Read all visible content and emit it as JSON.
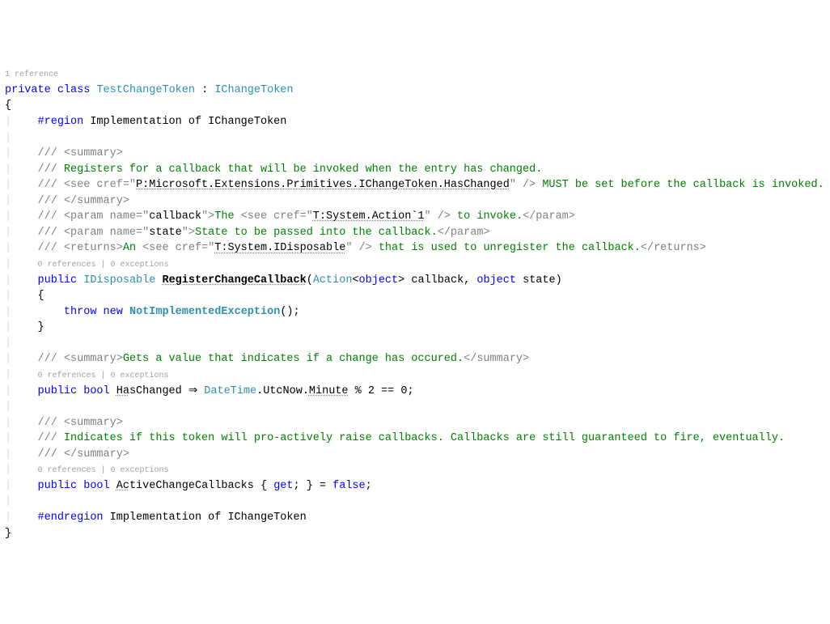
{
  "annotations": {
    "topRef": "1 reference",
    "refsExc": "0 references | 0 exceptions"
  },
  "tokens": {
    "private": "private",
    "class": "class",
    "TestChangeToken": "TestChangeToken",
    "colon": " : ",
    "IChangeToken": "IChangeToken",
    "lbrace": "{",
    "rbrace": "}",
    "region_hash": "#region",
    "region_text": " Implementation of IChangeToken",
    "endregion_hash": "#endregion",
    "endregion_text": " Implementation of IChangeToken",
    "xml_sl": "/// ",
    "sum_open": "<summary>",
    "sum_close": "</summary>",
    "sum1_l1": "Registers for a callback that will be invoked when the entry has changed.",
    "see_open": "<see cref=\"",
    "see_close": "\" />",
    "cref_haschanged": "P:Microsoft.Extensions.Primitives.IChangeToken.HasChanged",
    "sum1_l2_after": " MUST be set before the callback is invoked.",
    "param_open1": "<param name=\"",
    "param_callback": "callback",
    "param_mid": "\">",
    "param_close": "</param>",
    "p_cb_text1": "The ",
    "cref_action": "T:System.Action`1",
    "p_cb_text2": " to invoke.",
    "param_state": "state",
    "p_state_text": "State to be passed into the callback.",
    "returns_open": "<returns>",
    "returns_close": "</returns>",
    "ret_text1": "An ",
    "cref_idisp": "T:System.IDisposable",
    "ret_text2": " that is used to unregister the callback.",
    "public": "public",
    "IDisposable": "IDisposable",
    "RegisterChangeCallback": "RegisterChangeCallback",
    "lparen": "(",
    "rparen": ")",
    "Action": "Action",
    "lt": "<",
    "gt": ">",
    "object": "object",
    "sp": " ",
    "callback_id": "callback",
    "comma": ", ",
    "state_id": "state",
    "throw": "throw",
    "new": "new",
    "NotImplementedException": "NotImplementedException",
    "empty_parens": "();",
    "sum2": "Gets a value that indicates if a change has occured.",
    "bool": "bool",
    "HasChanged": "HasChanged",
    "Ha": "Ha",
    "sChanged": "sChanged",
    "arrow": " ⇒ ",
    "DateTime": "DateTime",
    "dot": ".",
    "UtcNow": "UtcNow",
    "Minute": "Minute",
    "mod_expr": " % 2 == 0;",
    "sum3": "Indicates if this token will pro-actively raise callbacks. Callbacks are still guaranteed to fire, eventually.",
    "ActiveChangeCallbacks": "ActiveChangeCallbacks",
    "Ac": "Ac",
    "tiveChangeCallbacks": "tiveChangeCallbacks",
    "getset": " { ",
    "get": "get",
    "getset2": "; } = ",
    "false": "false",
    "semi": ";"
  }
}
